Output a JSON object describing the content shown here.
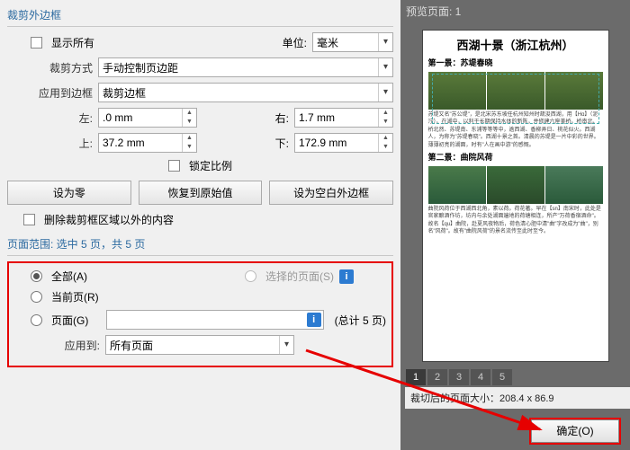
{
  "crop_section": {
    "header": "裁剪外边框",
    "show_all": "显示所有",
    "unit_label": "单位:",
    "unit_value": "毫米",
    "method_label": "裁剪方式",
    "method_value": "手动控制页边距",
    "apply_border_label": "应用到边框",
    "apply_border_value": "裁剪边框",
    "left_label": "左:",
    "left_value": ".0 mm",
    "right_label": "右:",
    "right_value": "1.7 mm",
    "top_label": "上:",
    "top_value": "37.2 mm",
    "bottom_label": "下:",
    "bottom_value": "172.9 mm",
    "lock_ratio": "锁定比例",
    "btn_zero": "设为零",
    "btn_restore": "恢复到原始值",
    "btn_blank": "设为空白外边框",
    "delete_outside": "删除裁剪框区域以外的内容"
  },
  "range_section": {
    "header": "页面范围: 选中 5 页，共 5 页",
    "opt_all": "全部(A)",
    "opt_selected": "选择的页面(S)",
    "opt_current": "当前页(R)",
    "opt_pages": "页面(G)",
    "total_pages": "(总计 5 页)",
    "apply_to_label": "应用到:",
    "apply_to_value": "所有页面"
  },
  "preview": {
    "header": "预览页面: 1",
    "doc_title": "西湖十景（浙江杭州）",
    "scene1": "第一景：苏堤春晓",
    "scene2": "第二景：曲院风荷",
    "pages": [
      "1",
      "2",
      "3",
      "4",
      "5"
    ],
    "size_text": "裁切后的页面大小：208.4 x 86.9"
  },
  "ok_button": "确定(O)"
}
